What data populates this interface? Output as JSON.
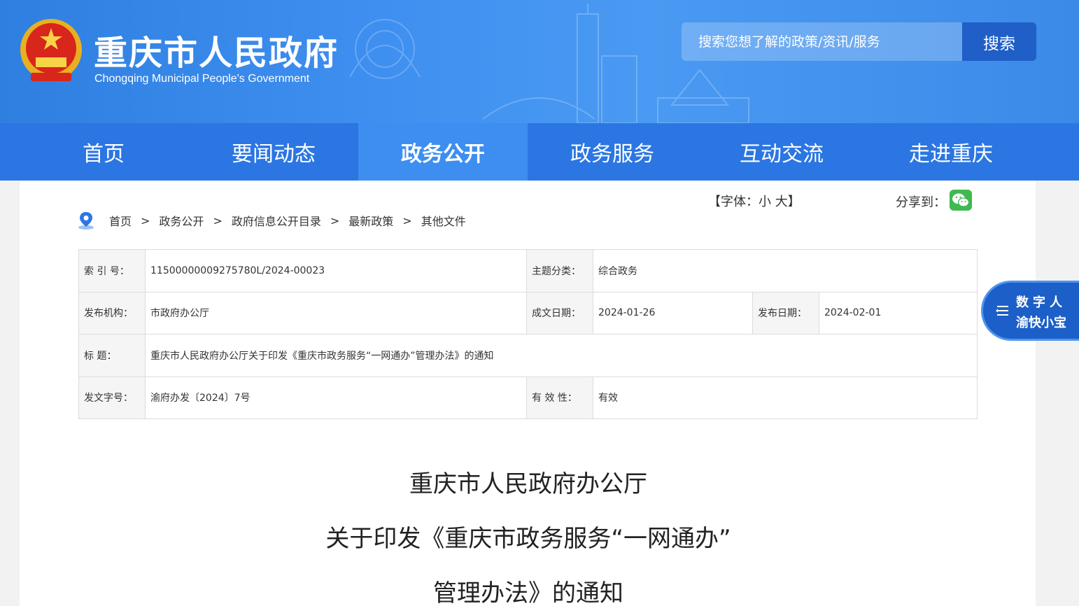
{
  "header": {
    "site_title": "重庆市人民政府",
    "site_subtitle": "Chongqing Municipal People's Government",
    "search_placeholder": "搜索您想了解的政策/资讯/服务",
    "search_button": "搜索"
  },
  "nav": {
    "items": [
      {
        "label": "首页"
      },
      {
        "label": "要闻动态"
      },
      {
        "label": "政务公开"
      },
      {
        "label": "政务服务"
      },
      {
        "label": "互动交流"
      },
      {
        "label": "走进重庆"
      }
    ],
    "active": "政务公开"
  },
  "toolbar": {
    "font_size_label": "【字体：",
    "font_small": "小",
    "font_large": "大",
    "font_close": "】",
    "share_label": "分享到："
  },
  "breadcrumb": {
    "items": [
      "首页",
      "政务公开",
      "政府信息公开目录",
      "最新政策",
      "其他文件"
    ],
    "separator": ">"
  },
  "meta": {
    "index_key": "索 引 号：",
    "index_value": "11500000009275780L/2024-00023",
    "topic_key": "主题分类：",
    "topic_value": "综合政务",
    "issuer_key": "发布机构：",
    "issuer_value": "市政府办公厅",
    "created_key": "成文日期：",
    "created_value": "2024-01-26",
    "published_key": "发布日期：",
    "published_value": "2024-02-01",
    "title_key": "标 题：",
    "title_value": "重庆市人民政府办公厅关于印发《重庆市政务服务“一网通办”管理办法》的通知",
    "doc_no_key": "发文字号：",
    "doc_no_value": "渝府办发〔2024〕7号",
    "validity_key": "有 效 性：",
    "validity_value": "有效"
  },
  "document": {
    "title_line1": "重庆市人民政府办公厅",
    "title_line2": "关于印发《重庆市政务服务“一网通办”",
    "title_line3": "管理办法》的通知"
  },
  "float_widget": {
    "line1": "数字人",
    "line2": "渝快小宝"
  },
  "colors": {
    "header_blue": "#3e8ff0",
    "nav_blue": "#2b76e2",
    "nav_active": "#3d8ef0",
    "search_button": "#1f5fc7",
    "wechat_green": "#3fb950"
  }
}
